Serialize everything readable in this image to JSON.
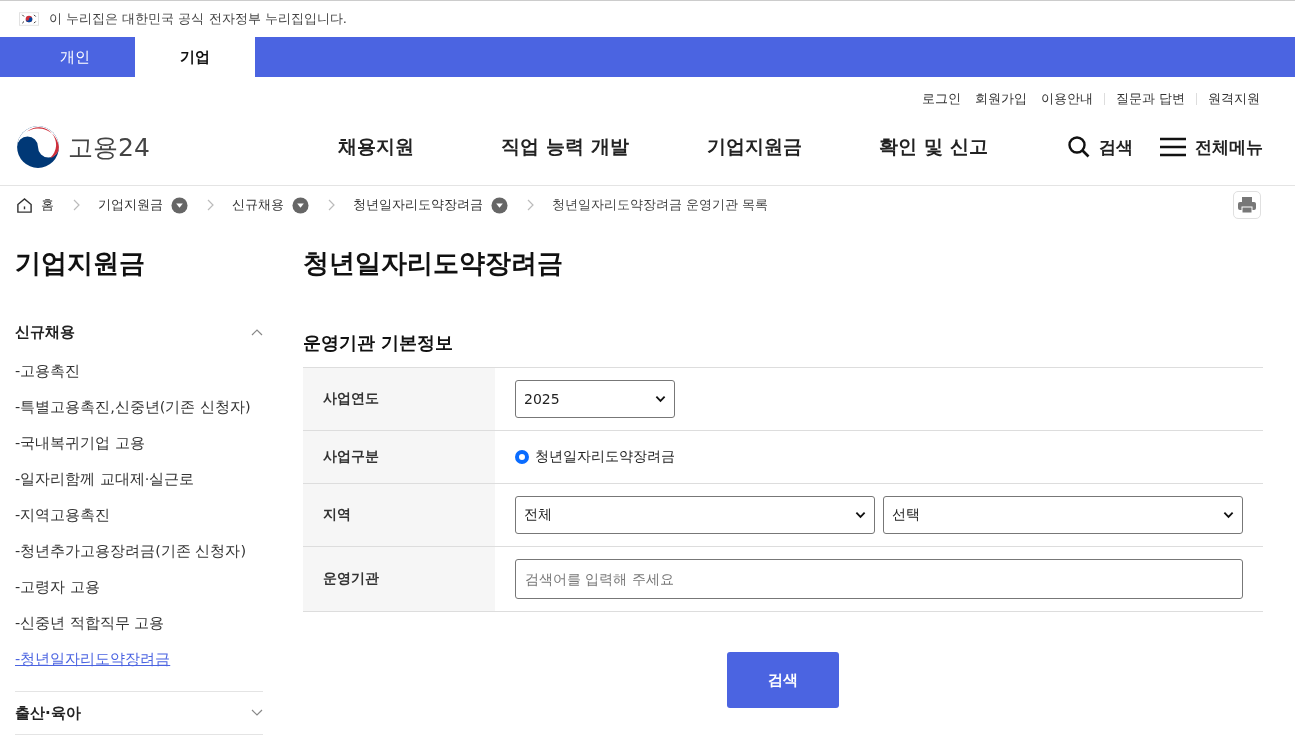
{
  "notice": {
    "text": "이 누리집은 대한민국 공식 전자정부 누리집입니다."
  },
  "user_tabs": [
    {
      "label": "개인",
      "selected": false
    },
    {
      "label": "기업",
      "selected": true
    }
  ],
  "utility_links": [
    "로그인",
    "회원가입",
    "이용안내",
    "질문과 답변",
    "원격지원"
  ],
  "logo": {
    "text": "고용24"
  },
  "main_nav": [
    "채용지원",
    "직업 능력 개발",
    "기업지원금",
    "확인 및 신고"
  ],
  "header_actions": {
    "search": "검색",
    "menu": "전체메뉴"
  },
  "breadcrumb": [
    {
      "label": "홈",
      "kind": "home"
    },
    {
      "label": "기업지원금",
      "kind": "dropdown"
    },
    {
      "label": "신규채용",
      "kind": "dropdown"
    },
    {
      "label": "청년일자리도약장려금",
      "kind": "dropdown"
    },
    {
      "label": "청년일자리도약장려금 운영기관 목록",
      "kind": "current"
    }
  ],
  "sidebar": {
    "title": "기업지원금",
    "groups": [
      {
        "label": "신규채용",
        "expanded": true,
        "children": [
          {
            "label": "-고용촉진",
            "selected": false
          },
          {
            "label": "-특별고용촉진,신중년(기존 신청자)",
            "selected": false
          },
          {
            "label": "-국내복귀기업 고용",
            "selected": false
          },
          {
            "label": "-일자리함께 교대제·실근로",
            "selected": false
          },
          {
            "label": "-지역고용촉진",
            "selected": false
          },
          {
            "label": "-청년추가고용장려금(기존 신청자)",
            "selected": false
          },
          {
            "label": "-고령자 고용",
            "selected": false
          },
          {
            "label": "-신중년 적합직무 고용",
            "selected": false
          },
          {
            "label": "-청년일자리도약장려금",
            "selected": true
          }
        ]
      },
      {
        "label": "출산·육아",
        "expanded": false
      }
    ]
  },
  "page_title": "청년일자리도약장려금",
  "section_title": "운영기관 기본정보",
  "form_rows": [
    {
      "label": "사업연도",
      "kind": "select",
      "controls": [
        {
          "value": "2025"
        }
      ]
    },
    {
      "label": "사업구분",
      "kind": "radio",
      "controls": [
        {
          "label": "청년일자리도약장려금",
          "checked": true
        }
      ]
    },
    {
      "label": "지역",
      "kind": "select",
      "controls": [
        {
          "value": "전체"
        },
        {
          "value": "선택"
        }
      ]
    },
    {
      "label": "운영기관",
      "kind": "input",
      "controls": [
        {
          "placeholder": "검색어를 입력해 주세요"
        }
      ]
    }
  ],
  "search_button": "검색"
}
